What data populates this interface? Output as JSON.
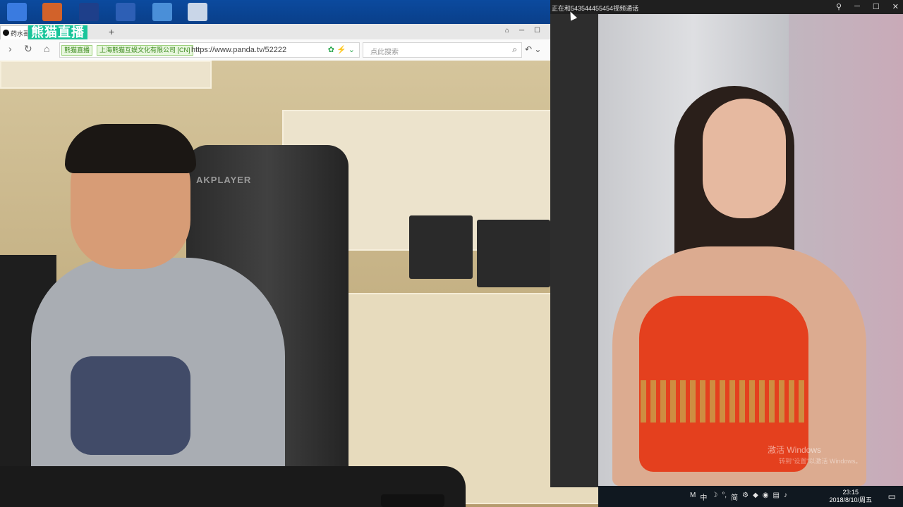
{
  "desktop": {
    "icons": [
      "app-icon",
      "photo-icon",
      "kx-icon",
      "word-icon",
      "doc-icon",
      "recycle-bin-icon"
    ]
  },
  "browser": {
    "tab_label": "药水哥",
    "logo_text": "熊猫直播",
    "new_tab": "+",
    "cert_badge": "熊猫直播",
    "cert_org": "上海熊猫互娱文化有限公司 [CN]",
    "url": "https://www.panda.tv/52222",
    "search_placeholder": "点此搜索"
  },
  "call": {
    "title": "正在和543544455454视频通话"
  },
  "scene": {
    "chair_brand": "AKPLAYER",
    "watermark_line1": "激活 Windows",
    "watermark_line2": "转到\"设置\"以激活 Windows。"
  },
  "tray": {
    "ime_mode": "中",
    "simplified": "简",
    "time": "23:15",
    "date": "2018/8/10/周五"
  }
}
